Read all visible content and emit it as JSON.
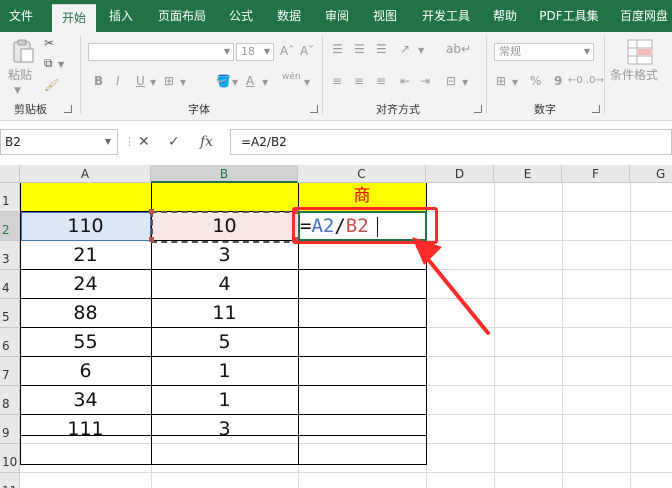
{
  "menu": {
    "tabs": [
      "文件",
      "开始",
      "插入",
      "页面布局",
      "公式",
      "数据",
      "审阅",
      "视图",
      "开发工具",
      "帮助",
      "PDF工具集",
      "百度网盘"
    ],
    "active": "开始"
  },
  "ribbon": {
    "clipboard": {
      "label": "剪贴板",
      "paste_label": "粘贴"
    },
    "font": {
      "label": "字体",
      "font_size": "18",
      "bold": "B",
      "italic": "I",
      "underline": "U",
      "grow": "Aˆ",
      "shrink": "Aˇ",
      "wen": "wén"
    },
    "alignment": {
      "label": "对齐方式"
    },
    "number": {
      "label": "数字",
      "format": "常规",
      "percent": "%",
      "comma": "9"
    },
    "styles": {
      "cond_format_label": "条件格式"
    }
  },
  "formula_bar": {
    "name_box": "B2",
    "cancel": "✕",
    "enter": "✓",
    "fx": "fx",
    "formula": "=A2/B2"
  },
  "sheet": {
    "columns": [
      "A",
      "B",
      "C",
      "D",
      "E",
      "F",
      "G"
    ],
    "rows": [
      "1",
      "2",
      "3",
      "4",
      "5",
      "6",
      "7",
      "8",
      "9",
      "10",
      "11"
    ],
    "header_c1": "商",
    "col_a": [
      "110",
      "21",
      "24",
      "88",
      "55",
      "6",
      "34",
      "111"
    ],
    "col_b": [
      "10",
      "3",
      "4",
      "11",
      "5",
      "1",
      "1",
      "3"
    ],
    "edit_cell": {
      "eq": "=",
      "ref1": "A2",
      "slash": "/",
      "ref2": "B2"
    },
    "colors": {
      "header_fill": "#ffff00",
      "header_text": "#ff0000",
      "ref1": "#4472c4",
      "ref2": "#c0504d",
      "annotation": "#ff2a2a",
      "accent": "#217346"
    }
  }
}
